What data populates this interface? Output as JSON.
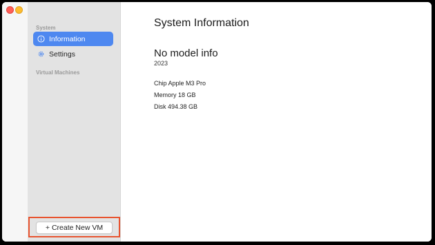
{
  "window": {
    "controls": [
      "close-icon",
      "minimize-icon"
    ],
    "colors": {
      "close": "#ff5f57",
      "minimize": "#febc2e",
      "accent": "#4e88f0",
      "highlight": "#e8532f"
    }
  },
  "sidebar": {
    "section_system": "System",
    "items": [
      {
        "label": "Information",
        "icon": "info-icon",
        "active": true
      },
      {
        "label": "Settings",
        "icon": "gear-icon",
        "active": false
      }
    ],
    "section_vms": "Virtual Machines",
    "create_button": "+ Create New VM"
  },
  "main": {
    "title": "System Information",
    "model": "No model info",
    "year": "2023",
    "chip": "Chip Apple M3 Pro",
    "memory": "Memory 18 GB",
    "disk": "Disk 494.38 GB"
  }
}
